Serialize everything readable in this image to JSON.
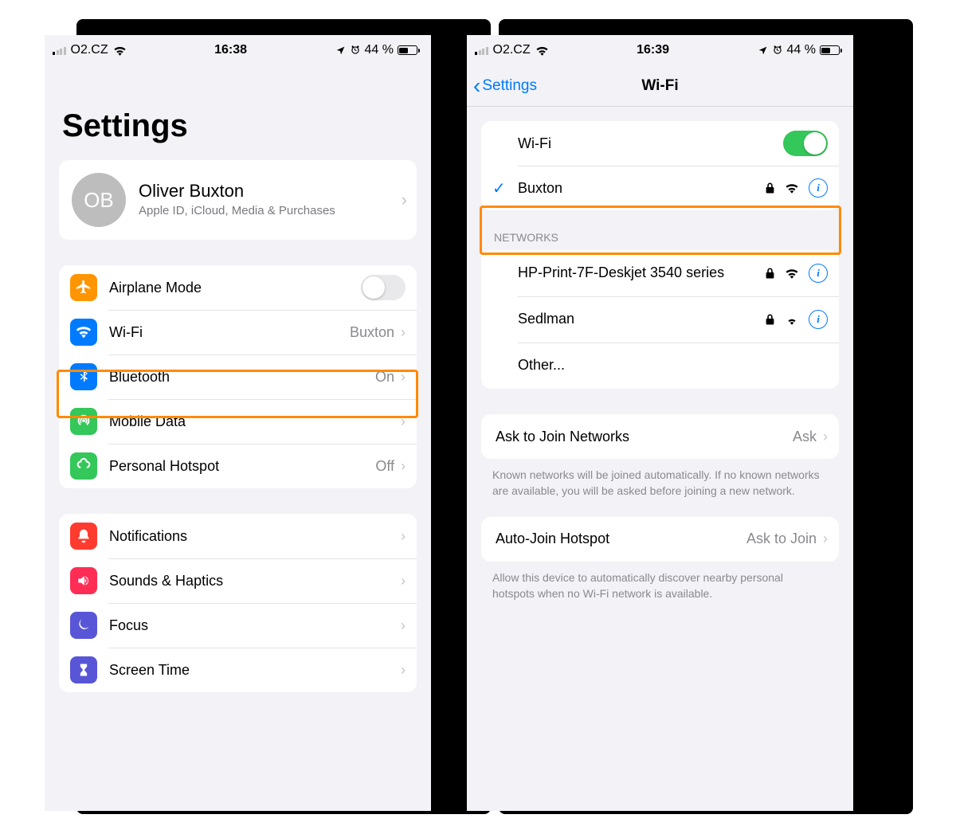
{
  "left": {
    "status": {
      "carrier": "O2.CZ",
      "time": "16:38",
      "battery": "44 %"
    },
    "title": "Settings",
    "appleId": {
      "initials": "OB",
      "name": "Oliver Buxton",
      "sub": "Apple ID, iCloud, Media & Purchases"
    },
    "rows1": [
      {
        "icon": "airplane",
        "color": "#ff9500",
        "label": "Airplane Mode",
        "toggle": false
      },
      {
        "icon": "wifi",
        "color": "#007aff",
        "label": "Wi-Fi",
        "value": "Buxton"
      },
      {
        "icon": "bluetooth",
        "color": "#007aff",
        "label": "Bluetooth",
        "value": "On"
      },
      {
        "icon": "mobiledata",
        "color": "#34c759",
        "label": "Mobile Data"
      },
      {
        "icon": "hotspot",
        "color": "#34c759",
        "label": "Personal Hotspot",
        "value": "Off"
      }
    ],
    "rows2": [
      {
        "icon": "notifications",
        "color": "#ff3b30",
        "label": "Notifications"
      },
      {
        "icon": "sounds",
        "color": "#ff2d55",
        "label": "Sounds & Haptics"
      },
      {
        "icon": "focus",
        "color": "#5856d6",
        "label": "Focus"
      },
      {
        "icon": "screentime",
        "color": "#5856d6",
        "label": "Screen Time"
      }
    ]
  },
  "right": {
    "status": {
      "carrier": "O2.CZ",
      "time": "16:39",
      "battery": "44 %"
    },
    "back": "Settings",
    "title": "Wi-Fi",
    "wifiLabel": "Wi-Fi",
    "connected": "Buxton",
    "networksHeader": "NETWORKS",
    "networks": [
      {
        "name": "HP-Print-7F-Deskjet 3540 series",
        "signal": 3
      },
      {
        "name": "Sedlman",
        "signal": 2
      }
    ],
    "other": "Other...",
    "askJoin": {
      "label": "Ask to Join Networks",
      "value": "Ask"
    },
    "askJoinDesc": "Known networks will be joined automatically. If no known networks are available, you will be asked before joining a new network.",
    "autoJoin": {
      "label": "Auto-Join Hotspot",
      "value": "Ask to Join"
    },
    "autoJoinDesc": "Allow this device to automatically discover nearby personal hotspots when no Wi-Fi network is available."
  }
}
